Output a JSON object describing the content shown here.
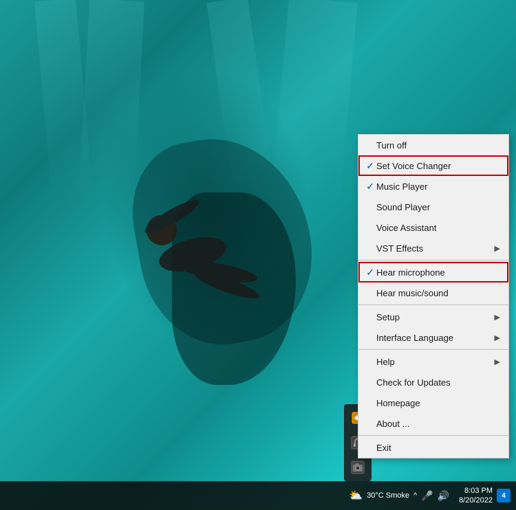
{
  "background": {
    "description": "Underwater scene with swimming figure"
  },
  "contextMenu": {
    "items": [
      {
        "id": "turn-off",
        "label": "Turn off",
        "checked": false,
        "hasArrow": false,
        "redBorder": false,
        "separator": false
      },
      {
        "id": "set-voice-changer",
        "label": "Set Voice Changer",
        "checked": true,
        "hasArrow": false,
        "redBorder": true,
        "separator": false
      },
      {
        "id": "music-player",
        "label": "Music Player",
        "checked": true,
        "hasArrow": false,
        "redBorder": false,
        "separator": false
      },
      {
        "id": "sound-player",
        "label": "Sound Player",
        "checked": false,
        "hasArrow": false,
        "redBorder": false,
        "separator": false
      },
      {
        "id": "voice-assistant",
        "label": "Voice Assistant",
        "checked": false,
        "hasArrow": false,
        "redBorder": false,
        "separator": false
      },
      {
        "id": "vst-effects",
        "label": "VST Effects",
        "checked": false,
        "hasArrow": true,
        "redBorder": false,
        "separator": false
      },
      {
        "id": "sep1",
        "separator": true
      },
      {
        "id": "hear-microphone",
        "label": "Hear microphone",
        "checked": true,
        "hasArrow": false,
        "redBorder": true,
        "separator": false
      },
      {
        "id": "hear-music",
        "label": "Hear music/sound",
        "checked": false,
        "hasArrow": false,
        "redBorder": false,
        "separator": false
      },
      {
        "id": "sep2",
        "separator": true
      },
      {
        "id": "setup",
        "label": "Setup",
        "checked": false,
        "hasArrow": true,
        "redBorder": false,
        "separator": false
      },
      {
        "id": "interface-language",
        "label": "Interface Language",
        "checked": false,
        "hasArrow": true,
        "redBorder": false,
        "separator": false
      },
      {
        "id": "sep3",
        "separator": true
      },
      {
        "id": "help",
        "label": "Help",
        "checked": false,
        "hasArrow": true,
        "redBorder": false,
        "separator": false
      },
      {
        "id": "check-updates",
        "label": "Check for Updates",
        "checked": false,
        "hasArrow": false,
        "redBorder": false,
        "separator": false
      },
      {
        "id": "homepage",
        "label": "Homepage",
        "checked": false,
        "hasArrow": false,
        "redBorder": false,
        "separator": false
      },
      {
        "id": "about",
        "label": "About ...",
        "checked": false,
        "hasArrow": false,
        "redBorder": false,
        "separator": false
      },
      {
        "id": "sep4",
        "separator": true
      },
      {
        "id": "exit",
        "label": "Exit",
        "checked": false,
        "hasArrow": false,
        "redBorder": false,
        "separator": false
      }
    ]
  },
  "taskbar": {
    "weather": "30°C  Smoke",
    "weatherIcon": "⛅",
    "time": "8:03 PM",
    "date": "8/20/2022",
    "notificationCount": "4",
    "chevronLabel": "^",
    "micIcon": "🎤",
    "speakerIcon": "🔊"
  },
  "sidePanel": {
    "icons": [
      {
        "id": "voice-app-icon",
        "symbol": "⚔",
        "title": "Voice App"
      },
      {
        "id": "headset-icon",
        "symbol": "🎧",
        "title": "Headset"
      },
      {
        "id": "camera-icon",
        "symbol": "📷",
        "title": "Camera"
      }
    ]
  }
}
